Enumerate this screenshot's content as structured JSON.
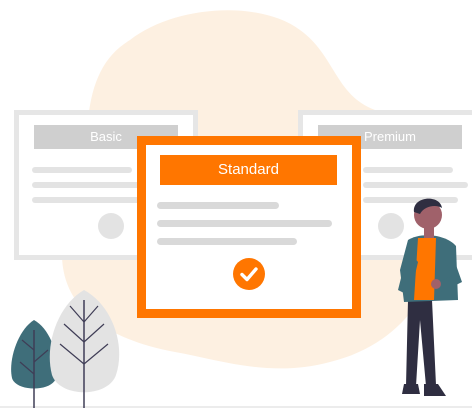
{
  "plans": {
    "basic": {
      "label": "Basic"
    },
    "standard": {
      "label": "Standard"
    },
    "premium": {
      "label": "Premium"
    }
  },
  "colors": {
    "accent": "#ff7600",
    "blob": "#fdf0e1",
    "card_border": "#e6e6e6",
    "muted_line": "#d9d9d9",
    "tree_teal": "#3f6e7a",
    "tree_grey": "#e3e3e3",
    "shirt": "#3f6e7a",
    "pants": "#2f2e41"
  },
  "icons": {
    "selected": "check-icon"
  }
}
